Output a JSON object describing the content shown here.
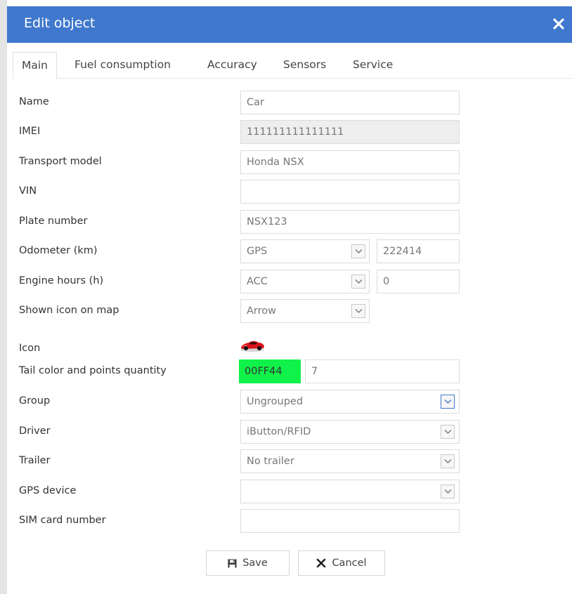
{
  "dialog": {
    "title": "Edit object",
    "close_glyph": "✕"
  },
  "tabs": [
    {
      "label": "Main",
      "active": true
    },
    {
      "label": "Fuel consumption",
      "active": false
    },
    {
      "label": "Accuracy",
      "active": false
    },
    {
      "label": "Sensors",
      "active": false
    },
    {
      "label": "Service",
      "active": false
    }
  ],
  "form": {
    "name": {
      "label": "Name",
      "value": "Car"
    },
    "imei": {
      "label": "IMEI",
      "value": "111111111111111"
    },
    "transport_model": {
      "label": "Transport model",
      "value": "Honda NSX"
    },
    "vin": {
      "label": "VIN",
      "value": ""
    },
    "plate_number": {
      "label": "Plate number",
      "value": "NSX123"
    },
    "odometer": {
      "label": "Odometer (km)",
      "source": "GPS",
      "value": "222414"
    },
    "engine_hours": {
      "label": "Engine hours (h)",
      "source": "ACC",
      "value": "0"
    },
    "shown_icon": {
      "label": "Shown icon on map",
      "value": "Arrow"
    },
    "icon": {
      "label": "Icon",
      "icon_name": "red-sports-car-icon"
    },
    "tail": {
      "label": "Tail color and points quantity",
      "color": "00FF44",
      "color_hex": "#10f24a",
      "points": "7"
    },
    "group": {
      "label": "Group",
      "value": "Ungrouped"
    },
    "driver": {
      "label": "Driver",
      "value": "iButton/RFID"
    },
    "trailer": {
      "label": "Trailer",
      "value": "No trailer"
    },
    "gps_device": {
      "label": "GPS device",
      "value": ""
    },
    "sim_card": {
      "label": "SIM card number",
      "value": ""
    }
  },
  "buttons": {
    "save_label": "Save",
    "cancel_label": "Cancel"
  },
  "colors": {
    "title_bar": "#3f78cc",
    "tail_swatch": "#10f24a"
  }
}
